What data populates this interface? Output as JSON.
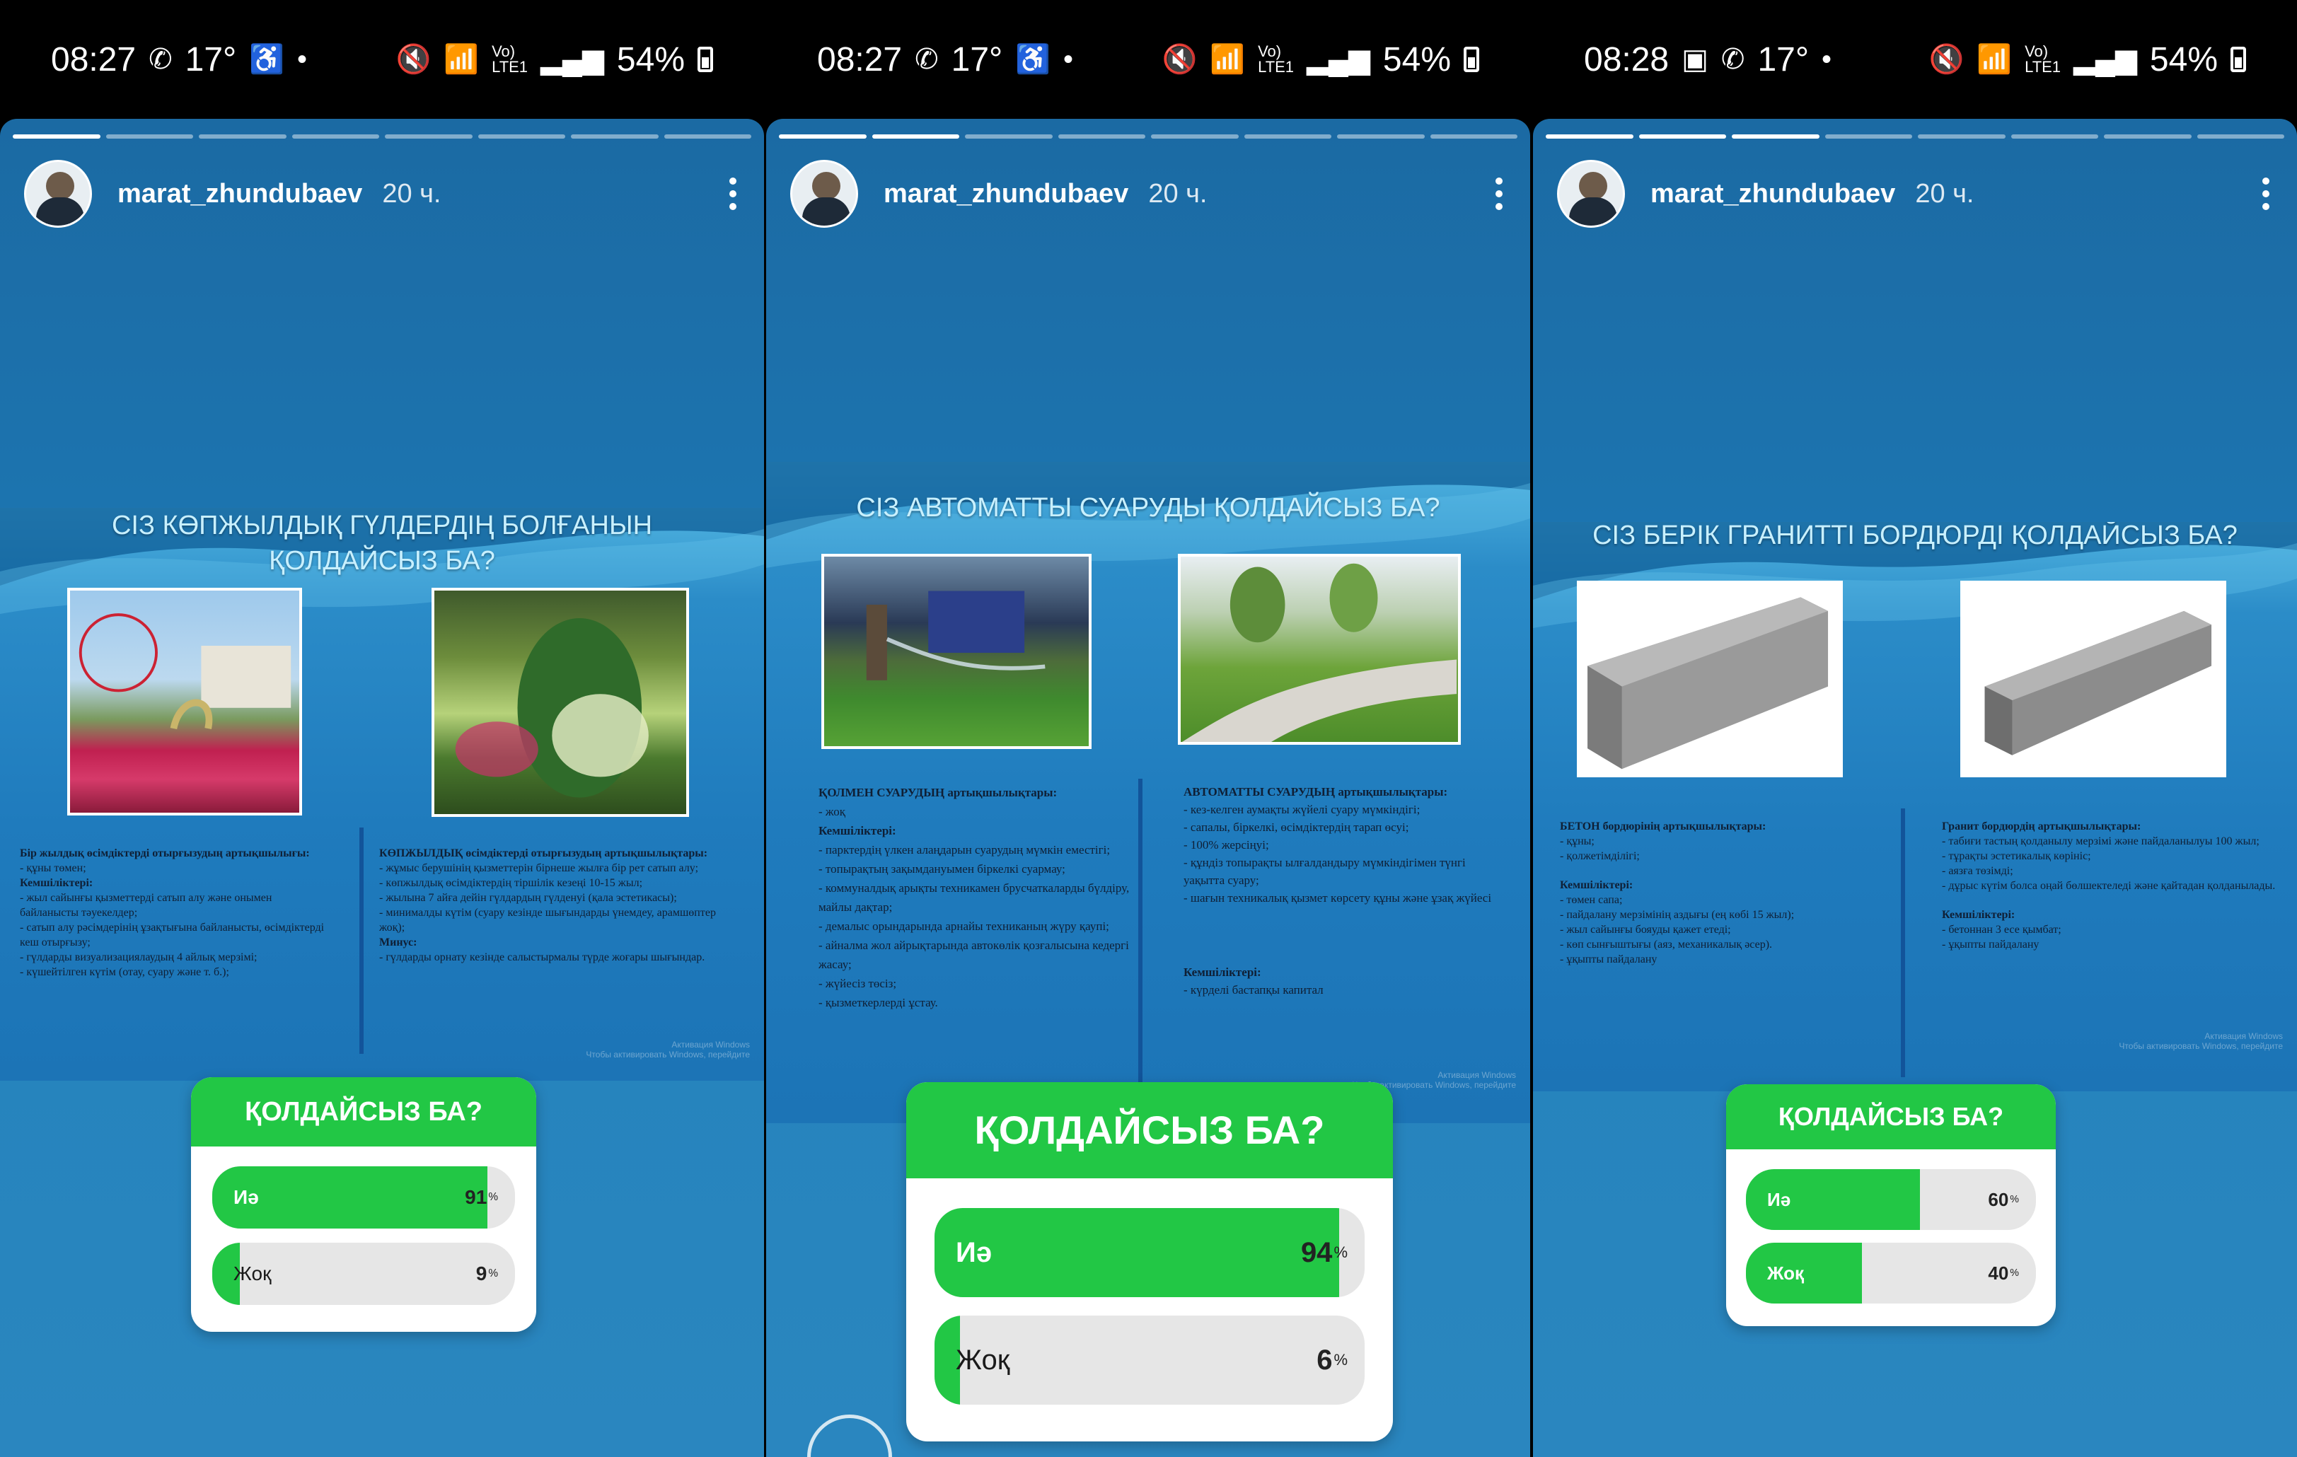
{
  "status_bars": [
    {
      "time": "08:27",
      "temp": "17°",
      "battery": "54%"
    },
    {
      "time": "08:27",
      "temp": "17°",
      "battery": "54%"
    },
    {
      "time": "08:28",
      "temp": "17°",
      "battery": "54%"
    }
  ],
  "stories": [
    {
      "username": "marat_zhundubaev",
      "time": "20 ч.",
      "progress": {
        "total": 8,
        "current": 1
      },
      "slide": {
        "title_line1": "СІЗ КӨПЖЫЛДЫҚ ГҮЛДЕРДІҢ БОЛҒАНЫН",
        "title_line2": "ҚОЛДАЙСЫЗ БА?",
        "left_text": {
          "heading": "Бір жылдық өсімдіктерді отырғызудың артықшылығы:",
          "lines": [
            "- құны төмен;"
          ],
          "sub_heading": "Кемшіліктері:",
          "sub_lines": [
            "- жыл сайынғы қызметтерді сатып алу және онымен байланысты тәуекелдер;",
            "- сатып алу рәсімдерінің ұзақтығына байланысты, өсімдіктерді кеш отырғызу;",
            "- гүлдарды визуализациялаудың 4 айлық мерзімі;",
            "- күшейтілген күтім (отау, суару және т. б.);"
          ]
        },
        "right_text": {
          "heading": "КӨПЖЫЛДЫҚ өсімдіктерді отырғызудың артықшылықтары:",
          "lines": [
            "- жұмыс берушінің қызметтерін бірнеше жылға бір рет сатып алу;",
            "- көпжылдық өсімдіктердің тіршілік кезеңі 10-15 жыл;",
            "- жылына 7 айға дейін гүлдардың гүлденуі (қала эстетикасы);",
            "- минималды күтім (суару кезінде шығындарды үнемдеу, арамшөптер жоқ);"
          ],
          "sub_heading": "Минус:",
          "sub_lines": [
            "- гүлдарды орнату кезінде салыстырмалы түрде жоғары шығындар."
          ]
        },
        "watermark_line1": "Активация Windows",
        "watermark_line2": "Чтобы активировать Windows, перейдите"
      },
      "poll": {
        "question": "ҚОЛДАЙСЫЗ БА?",
        "options": [
          {
            "label": "Иә",
            "percent": "91",
            "value": 91
          },
          {
            "label": "Жоқ",
            "percent": "9",
            "value": 9
          }
        ]
      }
    },
    {
      "username": "marat_zhundubaev",
      "time": "20 ч.",
      "progress": {
        "total": 8,
        "current": 2
      },
      "slide": {
        "title_line1": "СІЗ АВТОМАТТЫ СУАРУДЫ ҚОЛДАЙСЫЗ БА?",
        "left_text": {
          "heading": "ҚОЛМЕН СУАРУДЫҢ артықшылықтары:",
          "lines": [
            "- жоқ"
          ],
          "sub_heading": "Кемшіліктері:",
          "sub_lines": [
            "- парктердің үлкен алаңдарын суарудың мүмкін еместігі;",
            "- топырақтың зақымдануымен біркелкі суармау;",
            "- коммуналдық арықты техникамен брусчаткаларды бүлдіру, майлы дақтар;",
            "- демалыс орындарында арнайы техниканың жүру қаупі;",
            "- айналма жол айрықтарында автокөлік қозғалысына кедергі жасау;",
            "- жүйесіз төсiз;",
            "- қызметкерлерді ұстау."
          ]
        },
        "right_text": {
          "heading": "АВТОМАТТЫ СУАРУДЫҢ артықшылықтары:",
          "lines": [
            "- кез-келген аумақты жүйелі суару мүмкіндігі;",
            "- сапалы, біркелкі, өсімдіктердің тарап өсуі;",
            "- 100% жерсіңуі;",
            "- құндіз топырақты ылғалдандыру мүмкіндігімен түнгі уақытта суару;",
            "- шағын техникалық қызмет көрсету құны және ұзақ жүйесі"
          ],
          "sub_heading": "Кемшіліктері:",
          "sub_lines": [
            "- күрделі бастапқы капитал"
          ]
        },
        "watermark_line1": "Активация Windows",
        "watermark_line2": "Чтобы активировать Windows, перейдите"
      },
      "poll": {
        "question": "ҚОЛДАЙСЫЗ БА?",
        "options": [
          {
            "label": "Иә",
            "percent": "94",
            "value": 94
          },
          {
            "label": "Жоқ",
            "percent": "6",
            "value": 6
          }
        ]
      }
    },
    {
      "username": "marat_zhundubaev",
      "time": "20 ч.",
      "progress": {
        "total": 8,
        "current": 3
      },
      "slide": {
        "title_line1": "СІЗ БЕРІК ГРАНИТТІ БОРДЮРДІ ҚОЛДАЙСЫЗ БА?",
        "left_text": {
          "heading": "БЕТОН бордюрінің артықшылықтары:",
          "lines": [
            "- құны;",
            "- қолжетімділігі;"
          ],
          "sub_heading": "Кемшіліктері:",
          "sub_lines": [
            "- төмен сапа;",
            "- пайдалану мерзімінің аздығы (ең көбі 15 жыл);",
            "- жыл сайынғы бояуды қажет етеді;",
            "- көп сынғыштығы (аяз, механикалық әсер).",
            "- ұқыпты пайдалану"
          ]
        },
        "right_text": {
          "heading": "Гранит бордюрдің артықшылықтары:",
          "lines": [
            "- табиғи тастың қолданылу мерзімі және пайдаланылуы 100 жыл;",
            "- тұрақты эстетикалық көрініс;",
            "- аязға төзімді;",
            "- дұрыс күтім болса оңай бөлшектеледі және қайтадан қолданылады."
          ],
          "sub_heading": "Кемшіліктері:",
          "sub_lines": [
            "- бетоннан 3 есе қымбат;",
            "- ұқыпты пайдалану"
          ]
        },
        "watermark_line1": "Активация Windows",
        "watermark_line2": "Чтобы активировать Windows, перейдите"
      },
      "poll": {
        "question": "ҚОЛДАЙСЫЗ БА?",
        "options": [
          {
            "label": "Иә",
            "percent": "60",
            "value": 60
          },
          {
            "label": "Жоқ",
            "percent": "40",
            "value": 40
          }
        ]
      }
    }
  ],
  "icons": [
    "whatsapp-icon",
    "mute-icon",
    "wifi-icon",
    "volte-icon",
    "signal-icon",
    "battery-icon",
    "more-options-icon",
    "gallery-icon"
  ],
  "colors": {
    "poll_green": "#22c745",
    "story_blue": "#1d78b4",
    "title_cyan": "#c8f0ff"
  }
}
